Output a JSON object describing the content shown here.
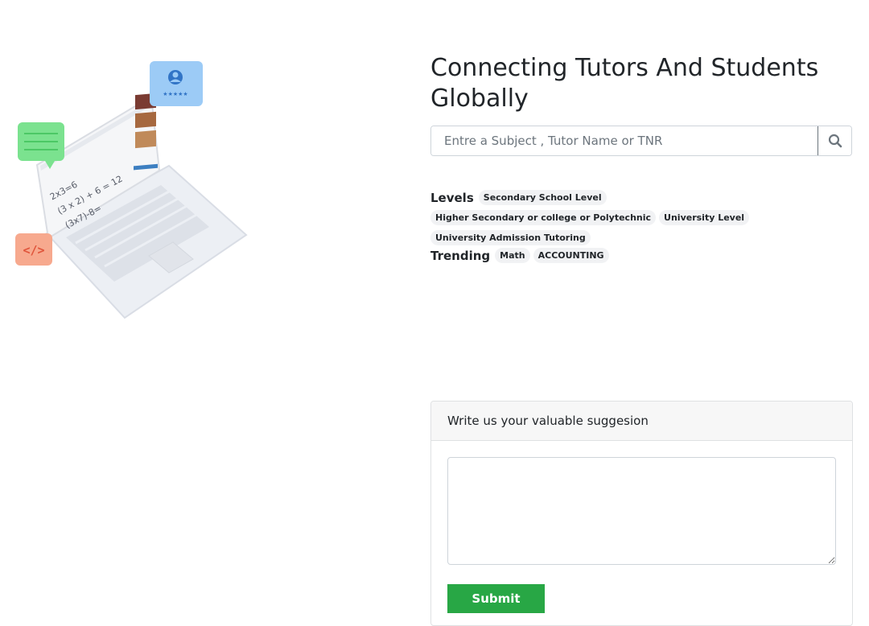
{
  "hero": {
    "title": "Connecting Tutors And Students Globally"
  },
  "search": {
    "placeholder": "Entre a Subject , Tutor Name or TNR",
    "button_icon": "search-icon"
  },
  "levels": {
    "heading": "Levels",
    "items": [
      "Secondary School Level",
      "Higher Secondary or college or Polytechnic",
      "University Level",
      "University Admission Tutoring"
    ]
  },
  "trending": {
    "heading": "Trending",
    "items": [
      "Math",
      "ACCOUNTING"
    ]
  },
  "illustration": {
    "equations": [
      "2x3=6",
      "(3 x 2) + 6 = 12",
      "(3x7)-8="
    ],
    "rating_stars": "★★★★★",
    "code_symbol": "</>",
    "colors": {
      "chat_green": "#7be28f",
      "profile_blue": "#9ccbf6",
      "code_orange": "#f7a98e"
    }
  },
  "suggestion": {
    "header": "Write us your valuable suggesion",
    "textarea_value": "",
    "submit_label": "Submit",
    "submit_color": "#28a745"
  }
}
